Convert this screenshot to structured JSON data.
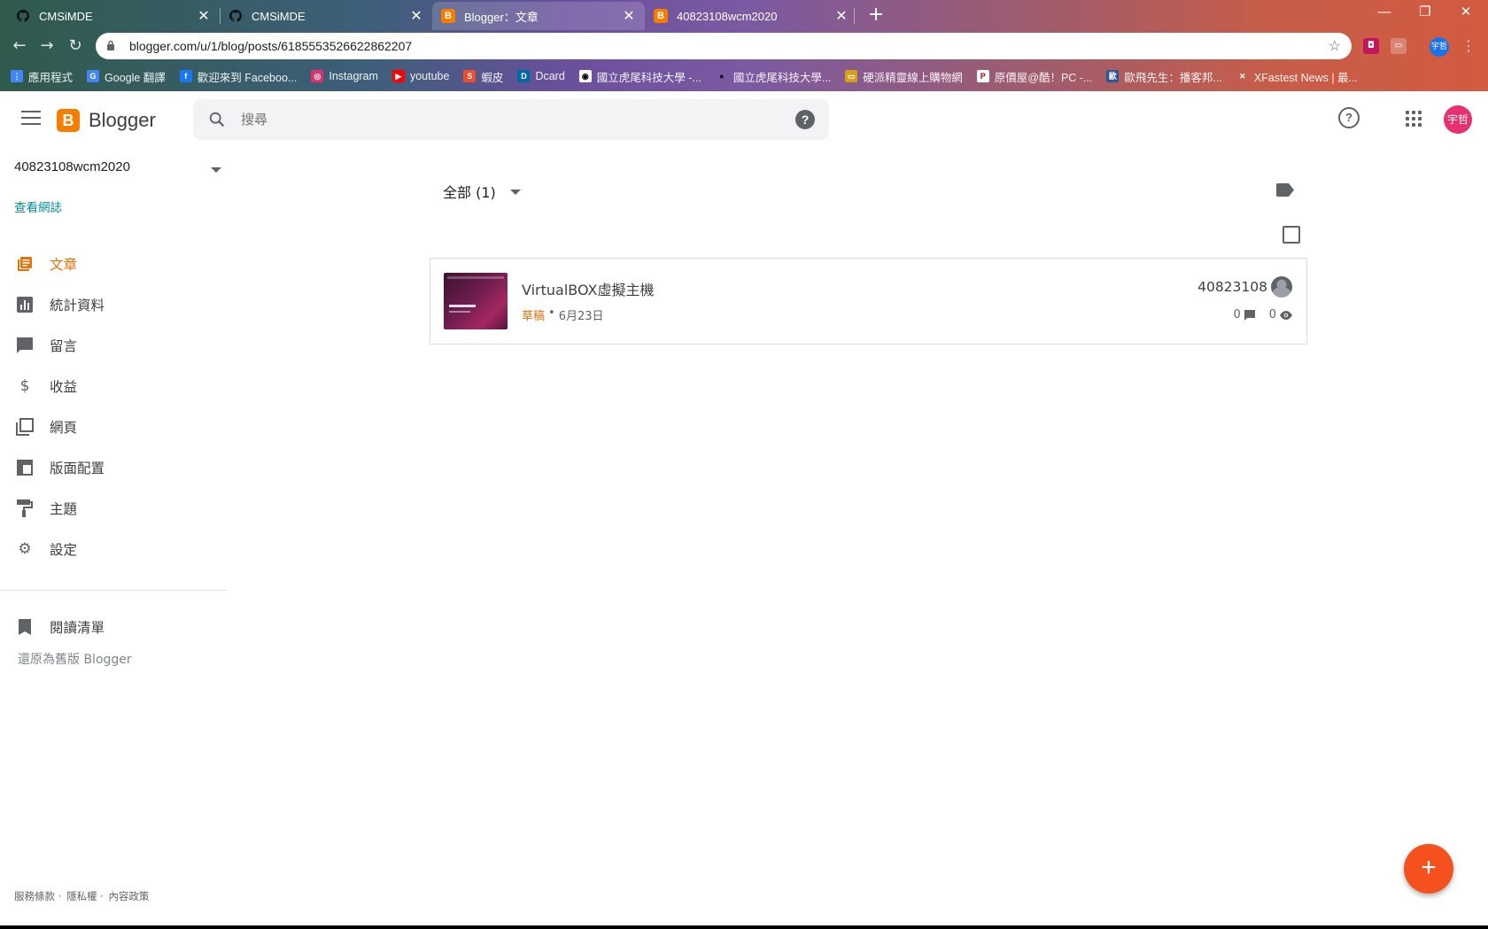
{
  "browser": {
    "tabs": [
      {
        "title": "CMSiMDE",
        "favicon": "github-icon"
      },
      {
        "title": "CMSiMDE",
        "favicon": "github-icon"
      },
      {
        "title": "Blogger：文章",
        "favicon": "blogger-icon"
      },
      {
        "title": "40823108wcm2020",
        "favicon": "blogger-icon"
      }
    ],
    "active_tab_index": 2,
    "url": "blogger.com/u/1/blog/posts/6185553526622862207",
    "profile_initials": "宇哲",
    "bookmarks": [
      {
        "label": "應用程式",
        "icon": "apps-grid-icon"
      },
      {
        "label": "Google 翻譯",
        "icon": "google-translate-icon"
      },
      {
        "label": "歡迎來到 Faceboo...",
        "icon": "facebook-icon"
      },
      {
        "label": "Instagram",
        "icon": "instagram-icon"
      },
      {
        "label": "youtube",
        "icon": "youtube-icon"
      },
      {
        "label": "蝦皮",
        "icon": "shopee-icon"
      },
      {
        "label": "Dcard",
        "icon": "dcard-icon"
      },
      {
        "label": "國立虎尾科技大學 -...",
        "icon": "nfu-icon"
      },
      {
        "label": "國立虎尾科技大學...",
        "icon": "github-icon"
      },
      {
        "label": "硬派精靈線上購物網",
        "icon": "coolpc-icon"
      },
      {
        "label": "原價屋@酷！PC -...",
        "icon": "pc-icon"
      },
      {
        "label": "歐飛先生：播客邦...",
        "icon": "podcast-icon"
      },
      {
        "label": "XFastest News | 最...",
        "icon": "xfastest-icon"
      }
    ]
  },
  "app": {
    "name": "Blogger",
    "search_placeholder": "搜尋",
    "avatar_initials": "宇哲",
    "brand_color": "#f57d00",
    "accent_color": "#e8710a"
  },
  "sidebar": {
    "blog_name": "40823108wcm2020",
    "view_blog": "查看網誌",
    "items": [
      {
        "label": "文章",
        "icon": "posts-icon",
        "active": true
      },
      {
        "label": "統計資料",
        "icon": "stats-icon",
        "active": false
      },
      {
        "label": "留言",
        "icon": "comments-icon",
        "active": false
      },
      {
        "label": "收益",
        "icon": "dollar-icon",
        "active": false
      },
      {
        "label": "網頁",
        "icon": "pages-icon",
        "active": false
      },
      {
        "label": "版面配置",
        "icon": "layout-icon",
        "active": false
      },
      {
        "label": "主題",
        "icon": "paint-roller-icon",
        "active": false
      },
      {
        "label": "設定",
        "icon": "gear-icon",
        "active": false
      }
    ],
    "reading_list": "閱讀清單",
    "revert": "還原為舊版 Blogger",
    "footer": [
      "服務條款",
      "隱私權",
      "內容政策"
    ],
    "footer_sep": "·"
  },
  "main": {
    "filter_label": "全部 (1)",
    "posts": [
      {
        "title": "VirtualBOX虛擬主機",
        "status": "草稿",
        "sep": "•",
        "date": "6月23日",
        "author": "40823108",
        "comments": "0",
        "views": "0"
      }
    ],
    "fab_label": "+"
  }
}
